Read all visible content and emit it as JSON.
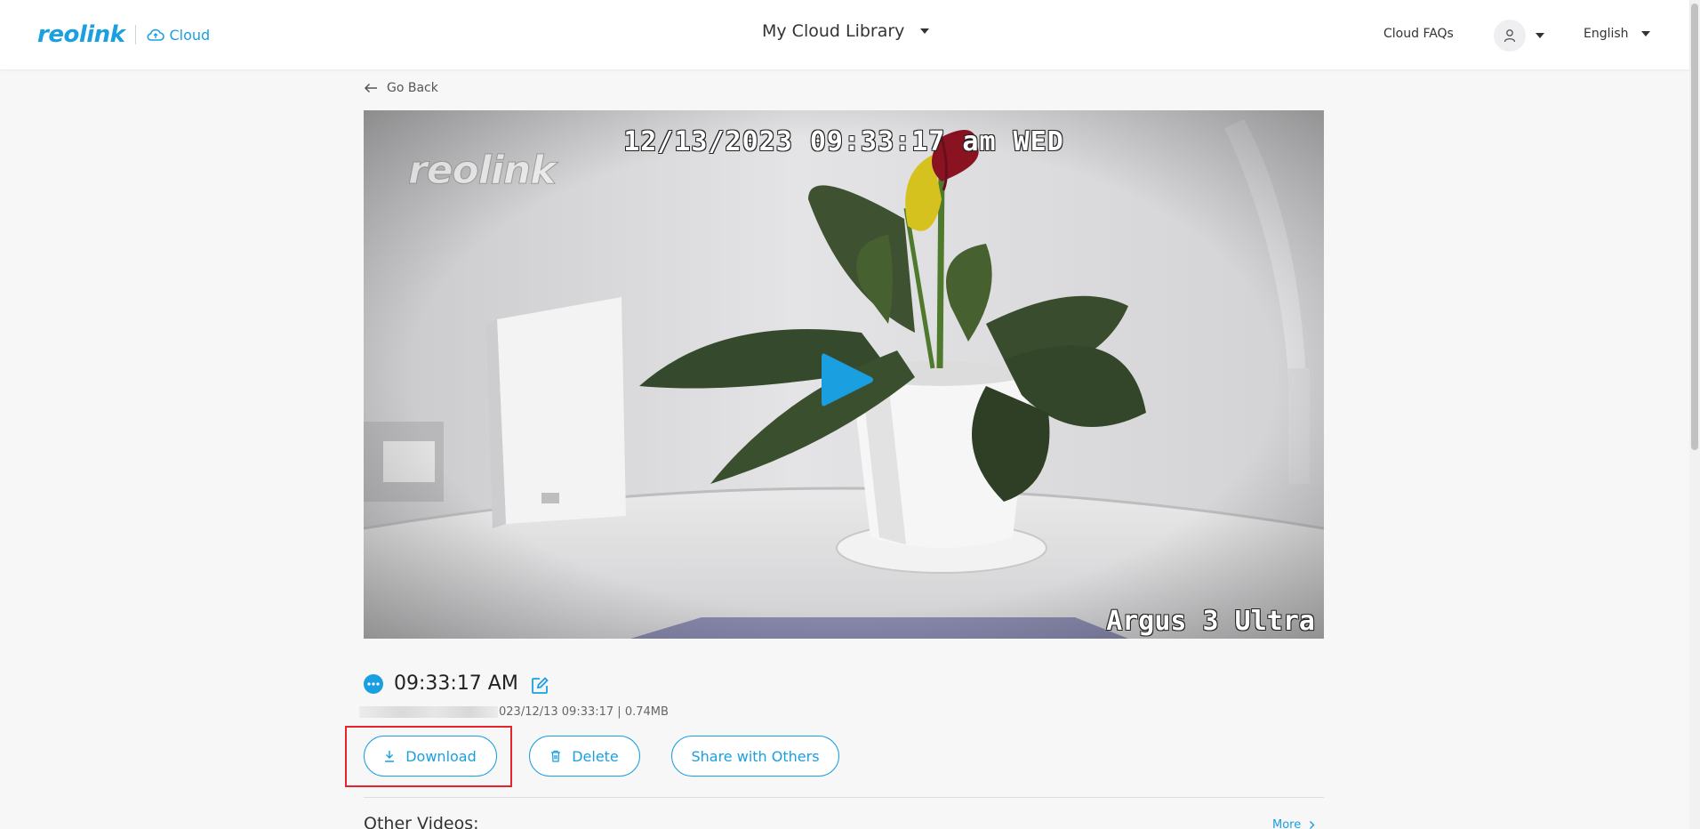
{
  "header": {
    "logo_text": "reolink",
    "cloud_label": "Cloud",
    "library_title": "My Cloud Library",
    "faqs_label": "Cloud FAQs",
    "language": "English"
  },
  "content": {
    "go_back_label": "Go Back",
    "video": {
      "osd_timestamp": "12/13/2023 09:33:17 am WED",
      "camera_model": "Argus 3 Ultra",
      "watermark": "reolink"
    },
    "clip_time": "09:33:17 AM",
    "meta_text": "023/12/13 09:33:17 | 0.74MB",
    "buttons": {
      "download": "Download",
      "delete": "Delete",
      "share": "Share with Others"
    },
    "other_videos_title": "Other Videos:",
    "more_label": "More"
  },
  "colors": {
    "accent": "#1a9fe0",
    "highlight": "#e8232b"
  },
  "icons": {
    "cloud": "cloud-icon",
    "user": "user-icon",
    "back": "arrow-left-icon",
    "play": "play-icon",
    "more": "ellipsis-icon",
    "edit": "edit-icon",
    "download": "download-icon",
    "delete": "trash-icon",
    "more_link": "chevron-right-icon"
  }
}
